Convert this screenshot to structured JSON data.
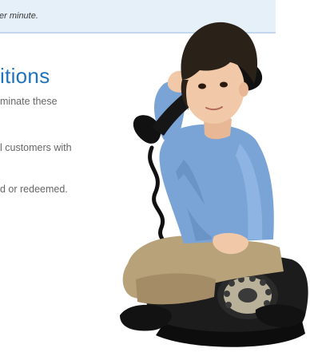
{
  "banner": {
    "text": "er minute."
  },
  "section": {
    "heading": "itions",
    "paragraphs": [
      "minate these",
      "l customers with",
      "d or redeemed."
    ]
  },
  "photo": {
    "subject": "boy-on-rotary-phone"
  },
  "colors": {
    "heading": "#1e73be",
    "banner_bg": "#e6f0f9",
    "body_text": "#666666"
  }
}
